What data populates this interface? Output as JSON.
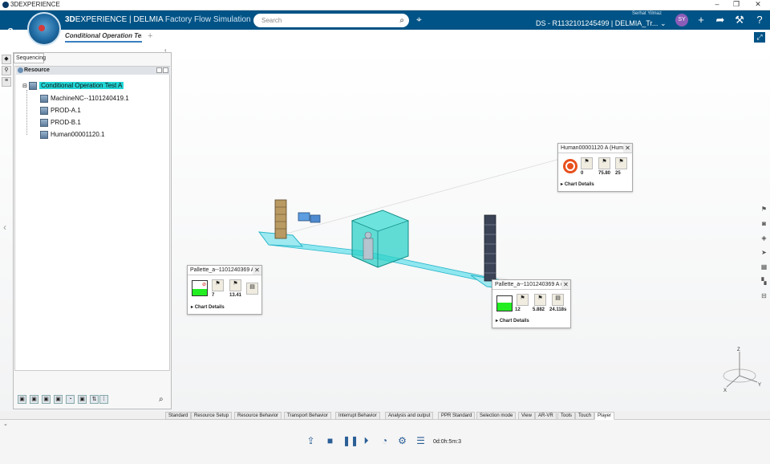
{
  "window": {
    "title": "3DEXPERIENCE",
    "min": "–",
    "max": "❐",
    "close": "✕"
  },
  "topbar": {
    "brand_bold": "3D",
    "brand_rest": "EXPERIENCE | DELMIA",
    "app_name": "Factory Flow Simulation",
    "search_placeholder": "Search",
    "user_name": "Serhat Yilmaz",
    "context": "DS - R1132101245499 | DELMIA_Tr...",
    "context_arrow": "⌄",
    "avatar": "SY",
    "icons": [
      "add-icon",
      "share-icon",
      "tools-icon",
      "help-icon"
    ],
    "icon_glyphs": [
      "+",
      "➦",
      "⚒",
      "?"
    ]
  },
  "tabs": {
    "active": "Conditional Operation Tes",
    "add": "+"
  },
  "panel": {
    "tab_label": "Sequencing",
    "header": "Resource",
    "tree": [
      {
        "label": "Conditional Operation Test A"
      },
      {
        "label": "MachineNC--1101240419.1"
      },
      {
        "label": "PROD-A.1"
      },
      {
        "label": "PROD-B.1"
      },
      {
        "label": "Human00001120.1"
      }
    ]
  },
  "popups": [
    {
      "title": "Human00001120 A (Hum",
      "values": [
        "0",
        "75.80",
        "25"
      ],
      "details": "Chart Details",
      "gauge_level": 0
    },
    {
      "title": "Pallette_a--1101240369 A",
      "values": [
        "7",
        "13.41"
      ],
      "details": "Chart Details",
      "gauge_level": 0.45
    },
    {
      "title": "Pallette_a--1101240369 A (",
      "values": [
        "12",
        "5.882",
        "24.118s"
      ],
      "details": "Chart Details",
      "gauge_level": 0.55
    }
  ],
  "command_tabs": [
    "Standard",
    "Resource Setup",
    "Resource Behavior",
    "Transport Behavior",
    "Interrupt Behavior",
    "Analysis and output",
    "PPR Standard",
    "Selection mode",
    "View",
    "AR-VR",
    "Tools",
    "Touch",
    "Player"
  ],
  "player": {
    "time": "0d:0h:5m:3"
  },
  "axes": {
    "x": "X",
    "y": "Y",
    "z": "Z"
  },
  "colors": {
    "topbar": "#005386",
    "selection": "#22d6d6",
    "gauge": "#22ee22",
    "machine": "#2ed1c8"
  }
}
